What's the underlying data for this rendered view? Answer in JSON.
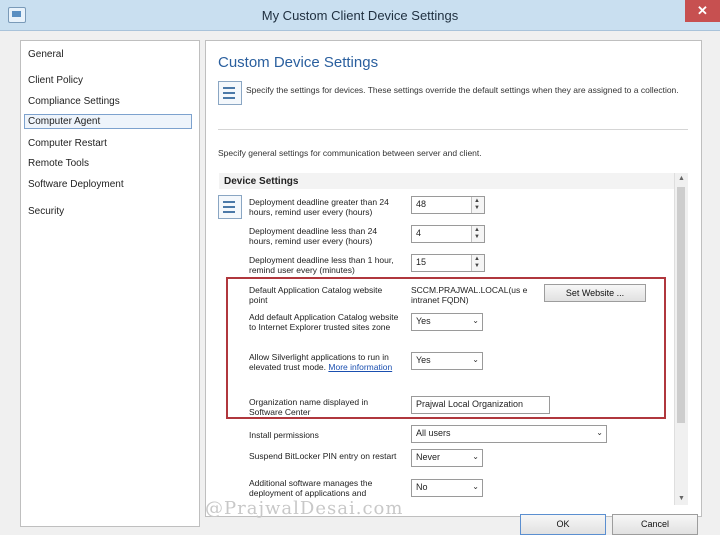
{
  "window": {
    "title": "My Custom Client Device Settings",
    "close_glyph": "✕"
  },
  "nav": {
    "items": [
      "General",
      "Client Policy",
      "Compliance Settings",
      "Computer Agent",
      "Computer Restart",
      "Remote Tools",
      "Software Deployment",
      "Security"
    ],
    "selected_index": 3
  },
  "main": {
    "heading": "Custom Device Settings",
    "description": "Specify the settings for devices. These settings override the default settings when they are assigned to a collection.",
    "general_text": "Specify general settings for communication between server and client.",
    "group_title": "Device Settings"
  },
  "settings": {
    "deadline_gt24": {
      "label": "Deployment deadline greater than 24 hours, remind user every (hours)",
      "value": "48"
    },
    "deadline_lt24": {
      "label": "Deployment deadline less than 24 hours, remind user every (hours)",
      "value": "4"
    },
    "deadline_lt1": {
      "label": "Deployment deadline less than 1 hour, remind user every (minutes)",
      "value": "15"
    },
    "catalog": {
      "label": "Default Application Catalog website point",
      "value": "SCCM.PRAJWAL.LOCAL(us e intranet FQDN)",
      "button": "Set Website ..."
    },
    "ie_trusted": {
      "label": "Add default Application Catalog website to Internet Explorer trusted sites zone",
      "value": "Yes"
    },
    "silverlight": {
      "label": "Allow Silverlight applications to run in elevated trust mode.",
      "link": "More information",
      "value": "Yes"
    },
    "org_name": {
      "label": "Organization name displayed in Software Center",
      "value": "Prajwal Local Organization"
    },
    "install_permissions": {
      "label": "Install permissions",
      "value": "All users"
    },
    "bitlocker": {
      "label": "Suspend BitLocker PIN entry on restart",
      "value": "Never"
    },
    "additional_sw": {
      "label": "Additional software manages the deployment of applications and",
      "value": "No"
    }
  },
  "buttons": {
    "ok": "OK",
    "cancel": "Cancel"
  },
  "watermark": "@PrajwalDesai.com",
  "icons": {
    "spin_up": "▲",
    "spin_down": "▼",
    "dropdown": "⌄",
    "scroll_up": "▲",
    "scroll_down": "▼"
  },
  "colors": {
    "heading": "#2a5f9e",
    "highlight_box": "#b0373d",
    "link": "#1a4fb0"
  }
}
